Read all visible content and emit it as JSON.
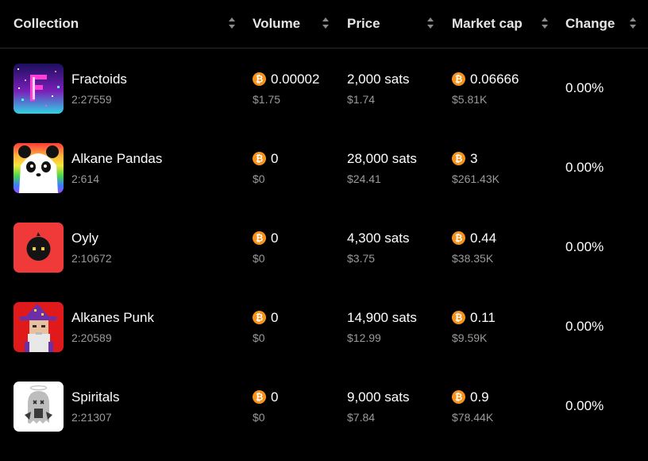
{
  "header": {
    "collection": "Collection",
    "volume": "Volume",
    "price": "Price",
    "market_cap": "Market cap",
    "change": "Change"
  },
  "colors": {
    "background": "#000000",
    "muted": "#9a9a9a",
    "bitcoin": "#f7931a"
  },
  "icons": {
    "currency": "bitcoin-icon",
    "sort": "sort-arrows-icon"
  },
  "rows": [
    {
      "name": "Fractoids",
      "id": "2:27559",
      "volume": "0.00002",
      "volume_usd": "$1.75",
      "price": "2,000 sats",
      "price_usd": "$1.74",
      "market_cap": "0.06666",
      "market_cap_usd": "$5.81K",
      "change": "0.00%"
    },
    {
      "name": "Alkane Pandas",
      "id": "2:614",
      "volume": "0",
      "volume_usd": "$0",
      "price": "28,000 sats",
      "price_usd": "$24.41",
      "market_cap": "3",
      "market_cap_usd": "$261.43K",
      "change": "0.00%"
    },
    {
      "name": "Oyly",
      "id": "2:10672",
      "volume": "0",
      "volume_usd": "$0",
      "price": "4,300 sats",
      "price_usd": "$3.75",
      "market_cap": "0.44",
      "market_cap_usd": "$38.35K",
      "change": "0.00%"
    },
    {
      "name": "Alkanes Punk",
      "id": "2:20589",
      "volume": "0",
      "volume_usd": "$0",
      "price": "14,900 sats",
      "price_usd": "$12.99",
      "market_cap": "0.11",
      "market_cap_usd": "$9.59K",
      "change": "0.00%"
    },
    {
      "name": "Spiritals",
      "id": "2:21307",
      "volume": "0",
      "volume_usd": "$0",
      "price": "9,000 sats",
      "price_usd": "$7.84",
      "market_cap": "0.9",
      "market_cap_usd": "$78.44K",
      "change": "0.00%"
    }
  ]
}
